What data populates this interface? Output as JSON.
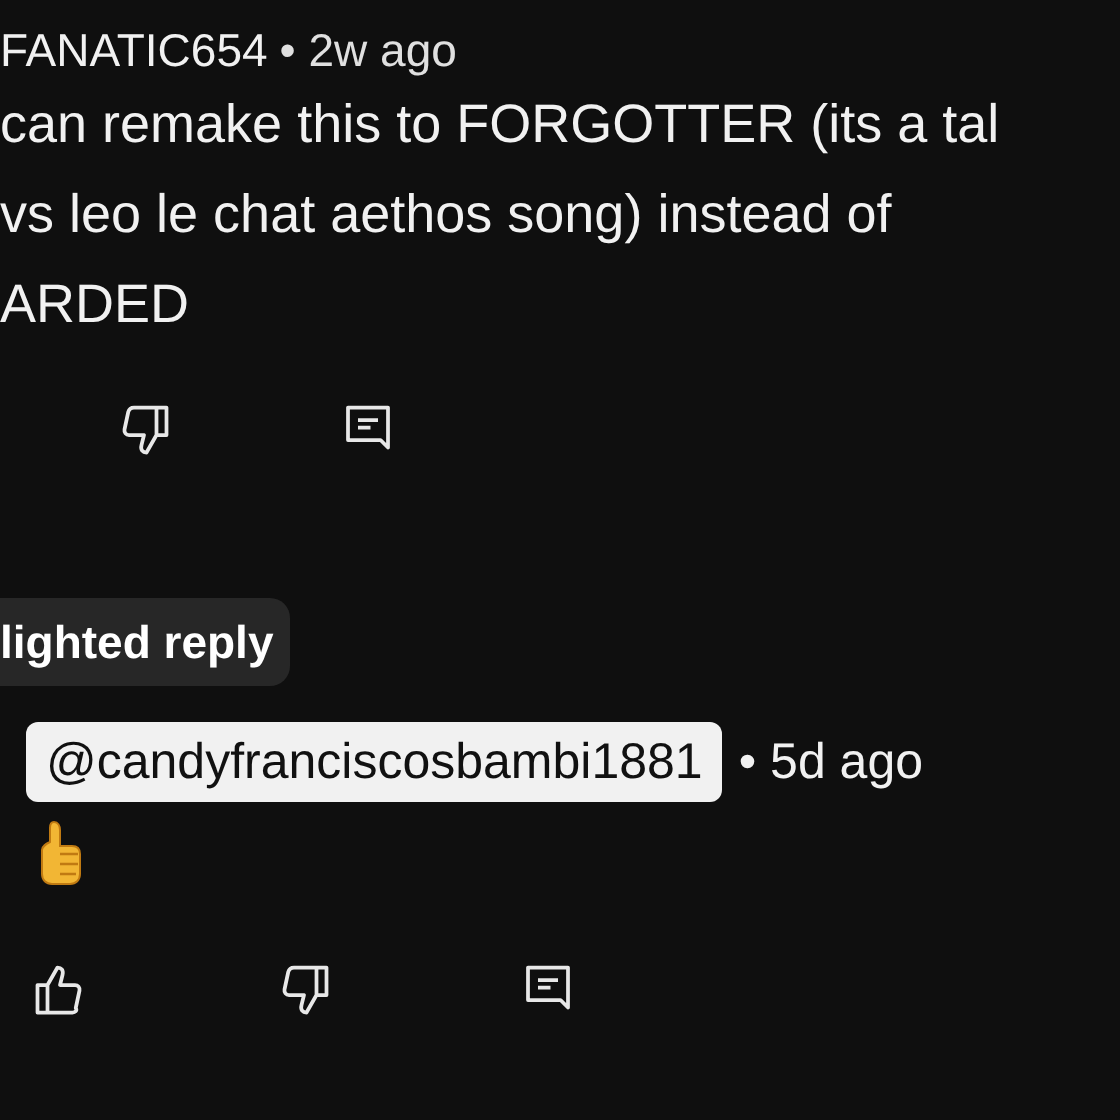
{
  "comment": {
    "author": "FANATIC654",
    "time": "• 2w ago",
    "text_lines": [
      "can remake this to FORGOTTER (its a tal",
      "vs leo le chat aethos song) instead of",
      "ARDED"
    ],
    "actions": [
      {
        "kind": "dislike"
      },
      {
        "kind": "reply"
      }
    ]
  },
  "highlighted_badge": "lighted reply",
  "reply": {
    "mention": "@candyfranciscosbambi1881",
    "time": "• 5d ago",
    "reaction": {
      "kind": "thumbs_up"
    },
    "actions": [
      {
        "kind": "like"
      },
      {
        "kind": "dislike"
      },
      {
        "kind": "reply"
      }
    ]
  }
}
